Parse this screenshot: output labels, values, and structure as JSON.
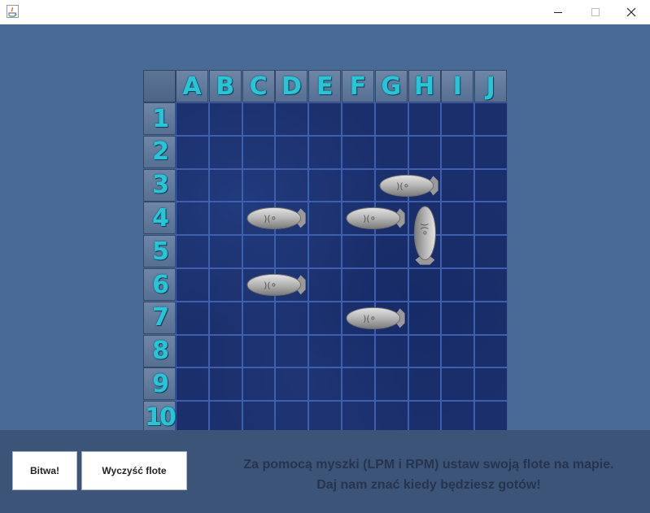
{
  "window": {
    "icon": "java-icon",
    "controls": {
      "minimize": "─",
      "maximize": "☐",
      "close": "✕"
    }
  },
  "board": {
    "columns": [
      "A",
      "B",
      "C",
      "D",
      "E",
      "F",
      "G",
      "H",
      "I",
      "J"
    ],
    "rows": [
      "1",
      "2",
      "3",
      "4",
      "5",
      "6",
      "7",
      "8",
      "9",
      "10"
    ],
    "ships": [
      {
        "row": 3,
        "col": 7,
        "length": 2,
        "orientation": "horizontal"
      },
      {
        "row": 4,
        "col": 3,
        "length": 2,
        "orientation": "horizontal"
      },
      {
        "row": 4,
        "col": 6,
        "length": 2,
        "orientation": "horizontal"
      },
      {
        "row": 4,
        "col": 8,
        "length": 2,
        "orientation": "vertical"
      },
      {
        "row": 6,
        "col": 3,
        "length": 2,
        "orientation": "horizontal"
      },
      {
        "row": 7,
        "col": 6,
        "length": 2,
        "orientation": "horizontal"
      }
    ]
  },
  "buttons": {
    "battle": "Bitwa!",
    "clear": "Wyczyść flote"
  },
  "message": {
    "line1": "Za pomocą myszki (LPM i RPM) ustaw swoją flote na mapie.",
    "line2": "Daj nam znać kiedy będziesz gotów!"
  }
}
